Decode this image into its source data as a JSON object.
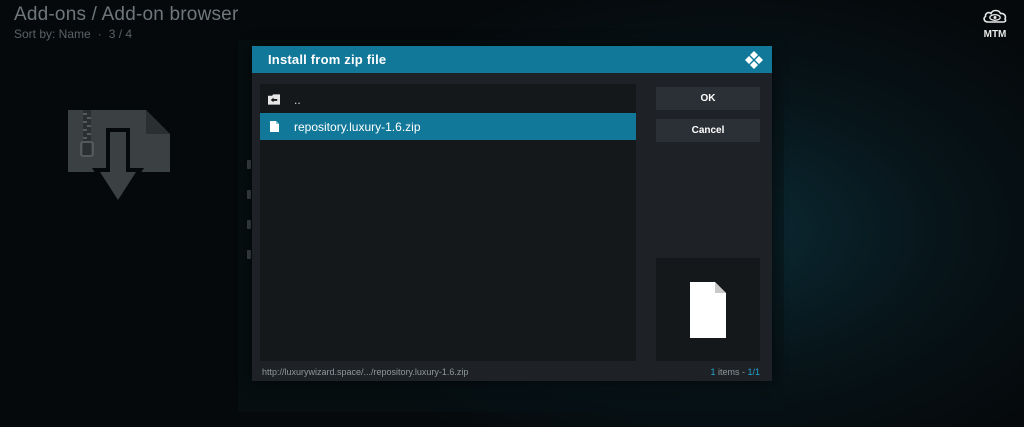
{
  "background": {
    "title": "Add-ons / Add-on browser",
    "sort_label": "Sort by: Name",
    "separator": "·",
    "position": "3 / 4"
  },
  "brand": {
    "label": "MTM",
    "icon": "eye-cloud-icon"
  },
  "dialog": {
    "title": "Install from zip file",
    "header_icon": "kodi-logo-icon",
    "items": [
      {
        "label": "..",
        "icon": "parent-folder-icon"
      },
      {
        "label": "repository.luxury-1.6.zip",
        "icon": "file-icon",
        "selected": true
      }
    ],
    "buttons": {
      "ok": "OK",
      "cancel": "Cancel"
    },
    "footer": {
      "path": "http://luxurywizard.space/.../repository.luxury-1.6.zip",
      "items_count": "1",
      "items_word": " items - ",
      "page": "1/1"
    }
  },
  "colors": {
    "accent": "#12789a",
    "dialog_bg": "#1e2226",
    "list_bg": "#15181b",
    "button_bg": "#2b3036"
  }
}
